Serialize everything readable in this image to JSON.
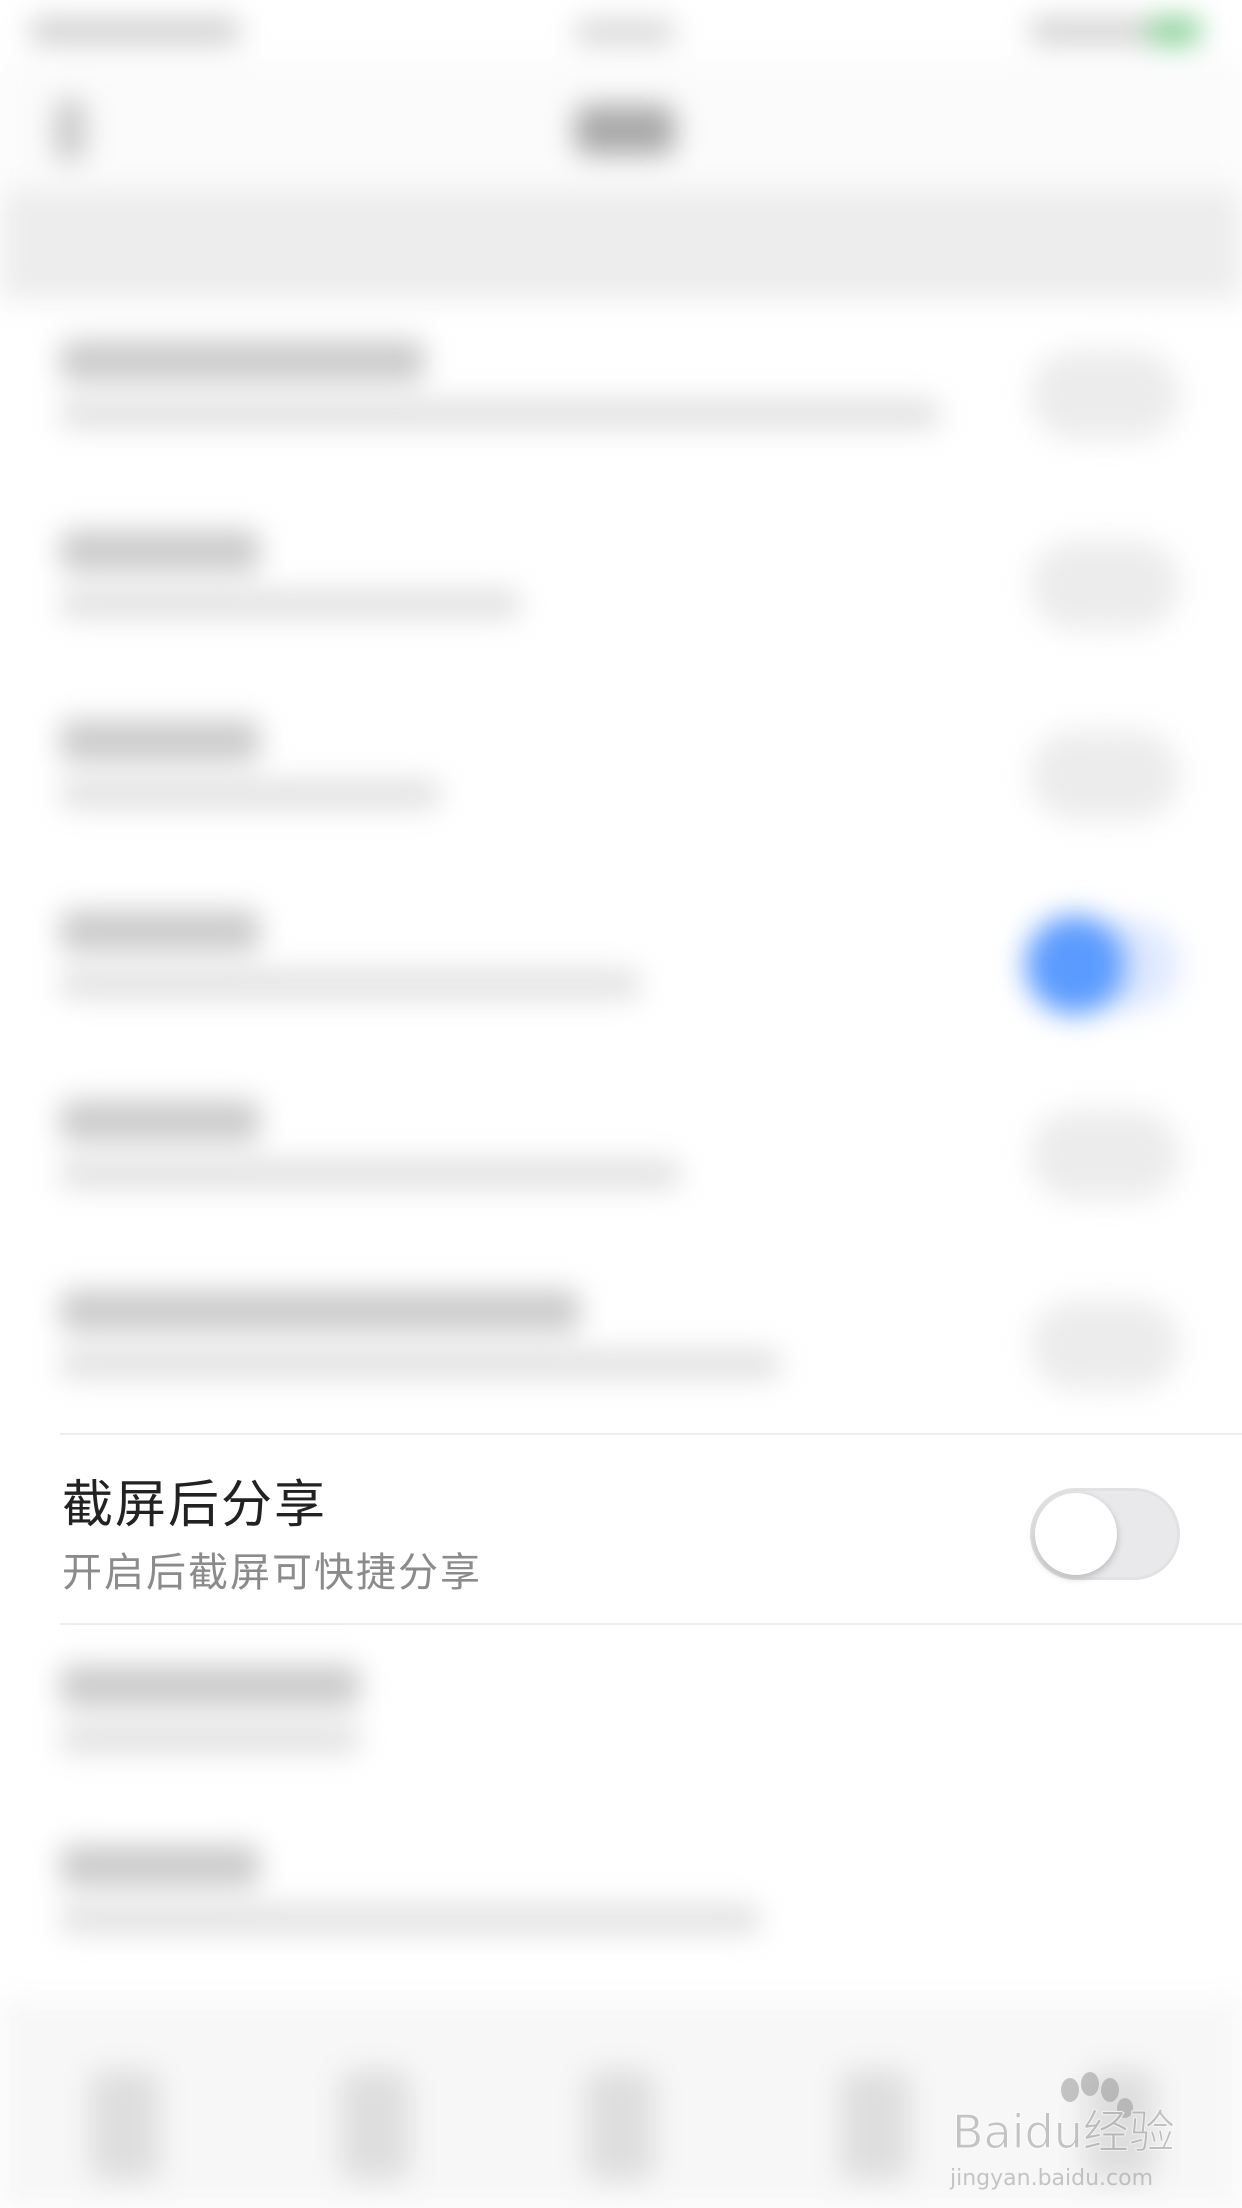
{
  "settings": {
    "screenshot_share": {
      "title": "截屏后分享",
      "subtitle": "开启后截屏可快捷分享",
      "toggle_on": false
    }
  },
  "colors": {
    "toggle_off_track": "#e9e9eb",
    "toggle_on_accent": "#5b9bff",
    "title_text": "#222222",
    "subtitle_text": "#8b8b8b"
  },
  "watermark": {
    "logo_text": "Baidu经验",
    "url_text": "jingyan.baidu.com"
  }
}
